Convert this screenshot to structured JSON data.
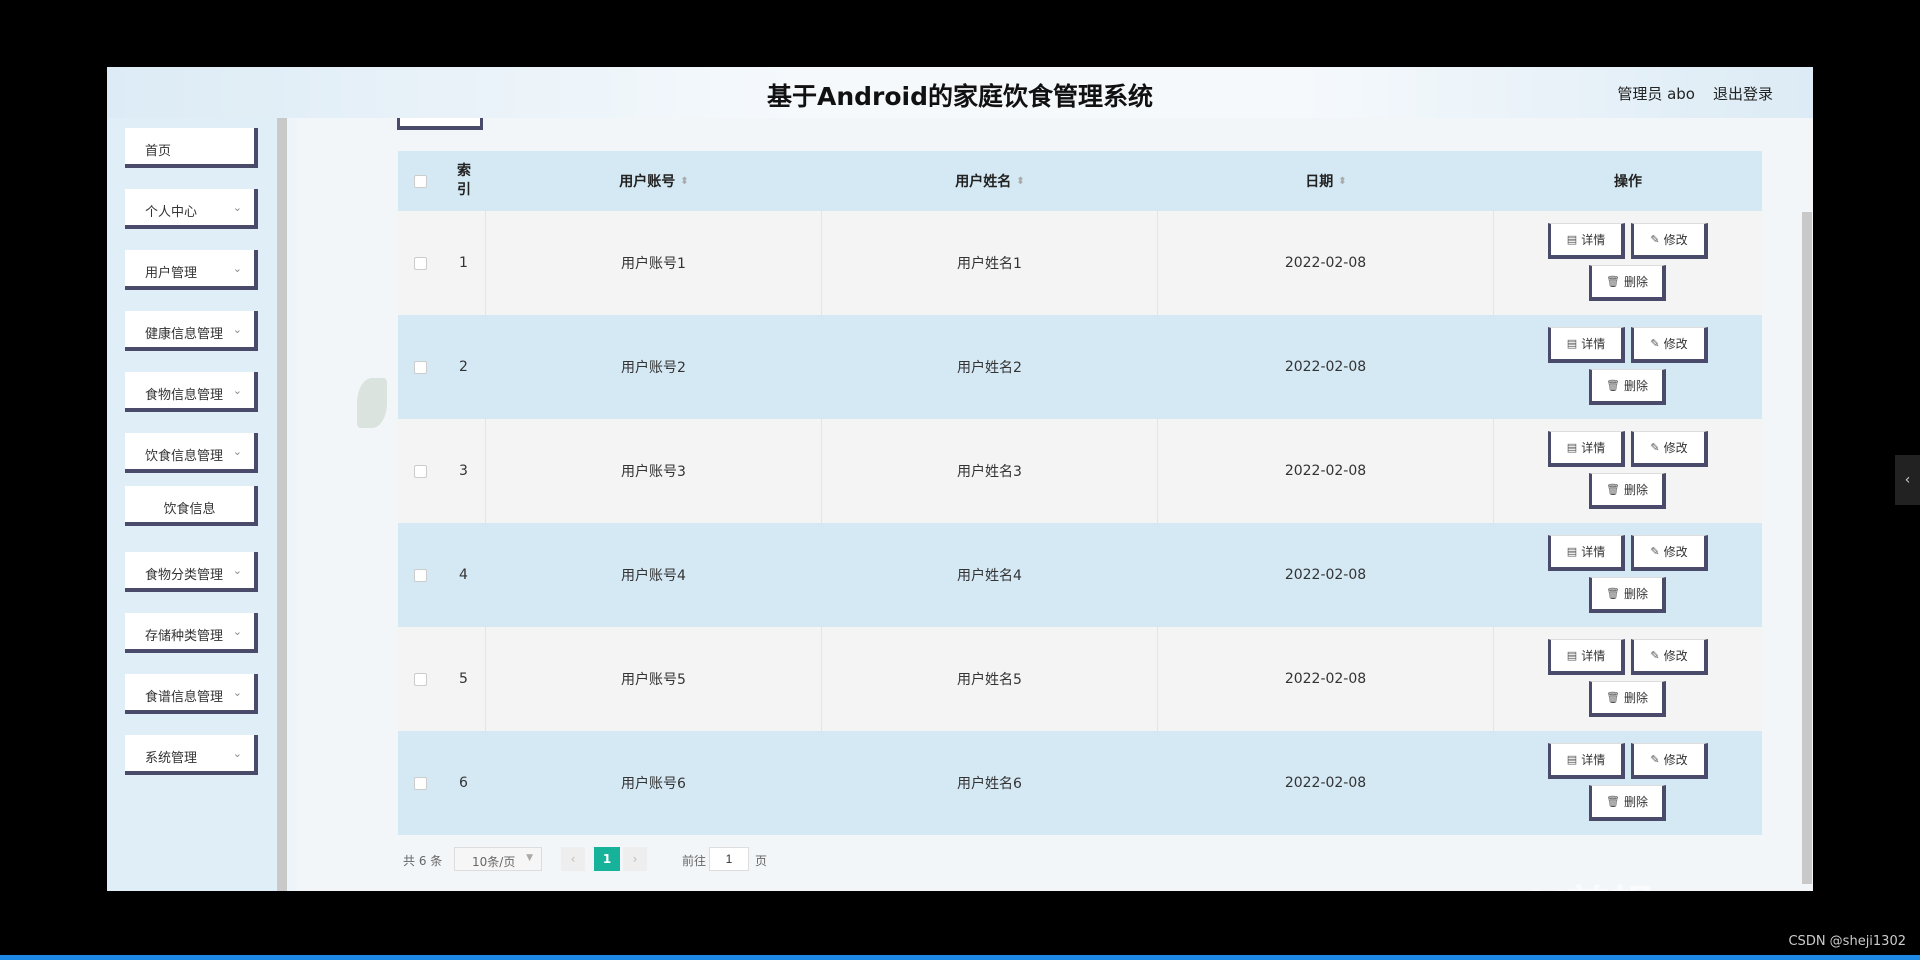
{
  "header": {
    "title": "基于Android的家庭饮食管理系统",
    "user_label": "管理员 abo",
    "logout_label": "退出登录"
  },
  "sidebar": {
    "items": [
      {
        "label": "首页",
        "expandable": false
      },
      {
        "label": "个人中心",
        "expandable": true
      },
      {
        "label": "用户管理",
        "expandable": true
      },
      {
        "label": "健康信息管理",
        "expandable": true
      },
      {
        "label": "食物信息管理",
        "expandable": true
      },
      {
        "label": "饮食信息管理",
        "expandable": true
      },
      {
        "label": "饮食信息",
        "expandable": false,
        "submenu": true
      },
      {
        "label": "食物分类管理",
        "expandable": true
      },
      {
        "label": "存储种类管理",
        "expandable": true
      },
      {
        "label": "食谱信息管理",
        "expandable": true
      },
      {
        "label": "系统管理",
        "expandable": true
      }
    ]
  },
  "table": {
    "headers": {
      "index": "索\n引",
      "account": "用户账号",
      "name": "用户姓名",
      "date": "日期",
      "ops": "操作"
    },
    "actions": {
      "detail": "详情",
      "edit": "修改",
      "delete": "删除"
    },
    "rows": [
      {
        "index": "1",
        "account": "用户账号1",
        "name": "用户姓名1",
        "date": "2022-02-08"
      },
      {
        "index": "2",
        "account": "用户账号2",
        "name": "用户姓名2",
        "date": "2022-02-08"
      },
      {
        "index": "3",
        "account": "用户账号3",
        "name": "用户姓名3",
        "date": "2022-02-08"
      },
      {
        "index": "4",
        "account": "用户账号4",
        "name": "用户姓名4",
        "date": "2022-02-08"
      },
      {
        "index": "5",
        "account": "用户账号5",
        "name": "用户姓名5",
        "date": "2022-02-08"
      },
      {
        "index": "6",
        "account": "用户账号6",
        "name": "用户姓名6",
        "date": "2022-02-08"
      }
    ]
  },
  "pager": {
    "total": "共 6 条",
    "page_size": "10条/页",
    "current_page": "1",
    "goto_label": "前往",
    "goto_value": "1",
    "page_unit": "页"
  },
  "overlay": {
    "credit": "CSDN @sheji1302",
    "watermark": "eV剪辑"
  },
  "colors": {
    "header_row": "#d5e9f5",
    "pager_active": "#17b29a",
    "button_border": "#4a4a6a"
  }
}
